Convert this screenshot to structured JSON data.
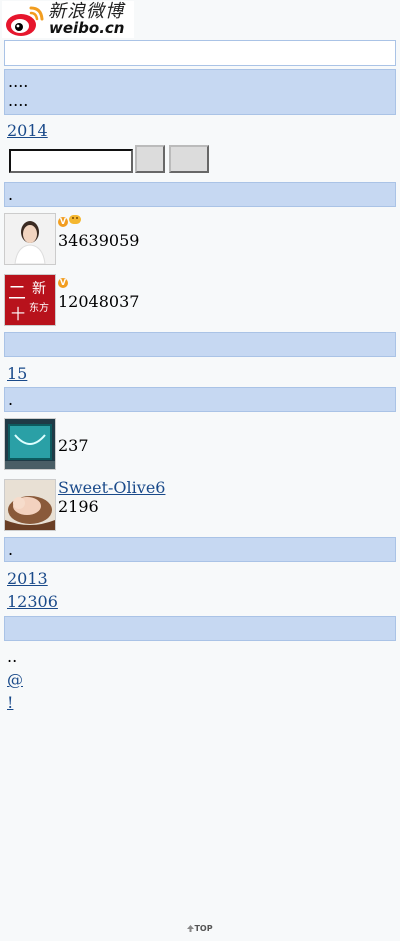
{
  "logo": {
    "cn_text": "新浪微博",
    "en_text": "weibo.cn"
  },
  "login_bar": {
    "items": [
      "",
      ""
    ]
  },
  "nav": {
    "row1": [
      "",
      "",
      "",
      "",
      ""
    ],
    "row2": [
      "",
      "",
      "",
      "",
      ""
    ]
  },
  "headlines": {
    "items": [
      "",
      "",
      "2014"
    ]
  },
  "search": {
    "value": "",
    "search_label": "",
    "advanced_label": ""
  },
  "star_section": {
    "title_parts": [
      "",
      ""
    ],
    "users": [
      {
        "name": "",
        "fans": "34639059",
        "follow_label": "",
        "badges": [
          "v-orange-icon",
          "gold-medal-icon"
        ]
      },
      {
        "name": "",
        "fans": "12048037",
        "follow_label": "",
        "badges": [
          "v-orange-icon"
        ],
        "avatar_text": [
          "二",
          "新",
          "十",
          "东方"
        ]
      }
    ]
  },
  "hot_section": {
    "title": "",
    "items": [
      "",
      "",
      "",
      "",
      "15"
    ]
  },
  "grass_section": {
    "title_parts": [
      "",
      ""
    ],
    "users": [
      {
        "name": "",
        "fans": "237",
        "follow_label": ""
      },
      {
        "name": "Sweet-Olive6",
        "fans": "2196",
        "follow_label": ""
      }
    ]
  },
  "topic_section": {
    "title_parts": [
      "",
      ""
    ],
    "items": [
      "",
      "",
      "2013",
      "",
      "12306"
    ]
  },
  "footer_section": {
    "title": "",
    "links_row1": [
      "",
      "",
      ""
    ],
    "line2_left": "@",
    "line2_right": "",
    "line3": "!"
  },
  "footer_top": {
    "label": "TOP"
  },
  "colors": {
    "link": "#1a4a8a",
    "section_bg": "#c6d8f2",
    "section_border": "#aac3e6",
    "page_bg": "#f7f9fa",
    "badge_orange": "#f29d1f"
  }
}
